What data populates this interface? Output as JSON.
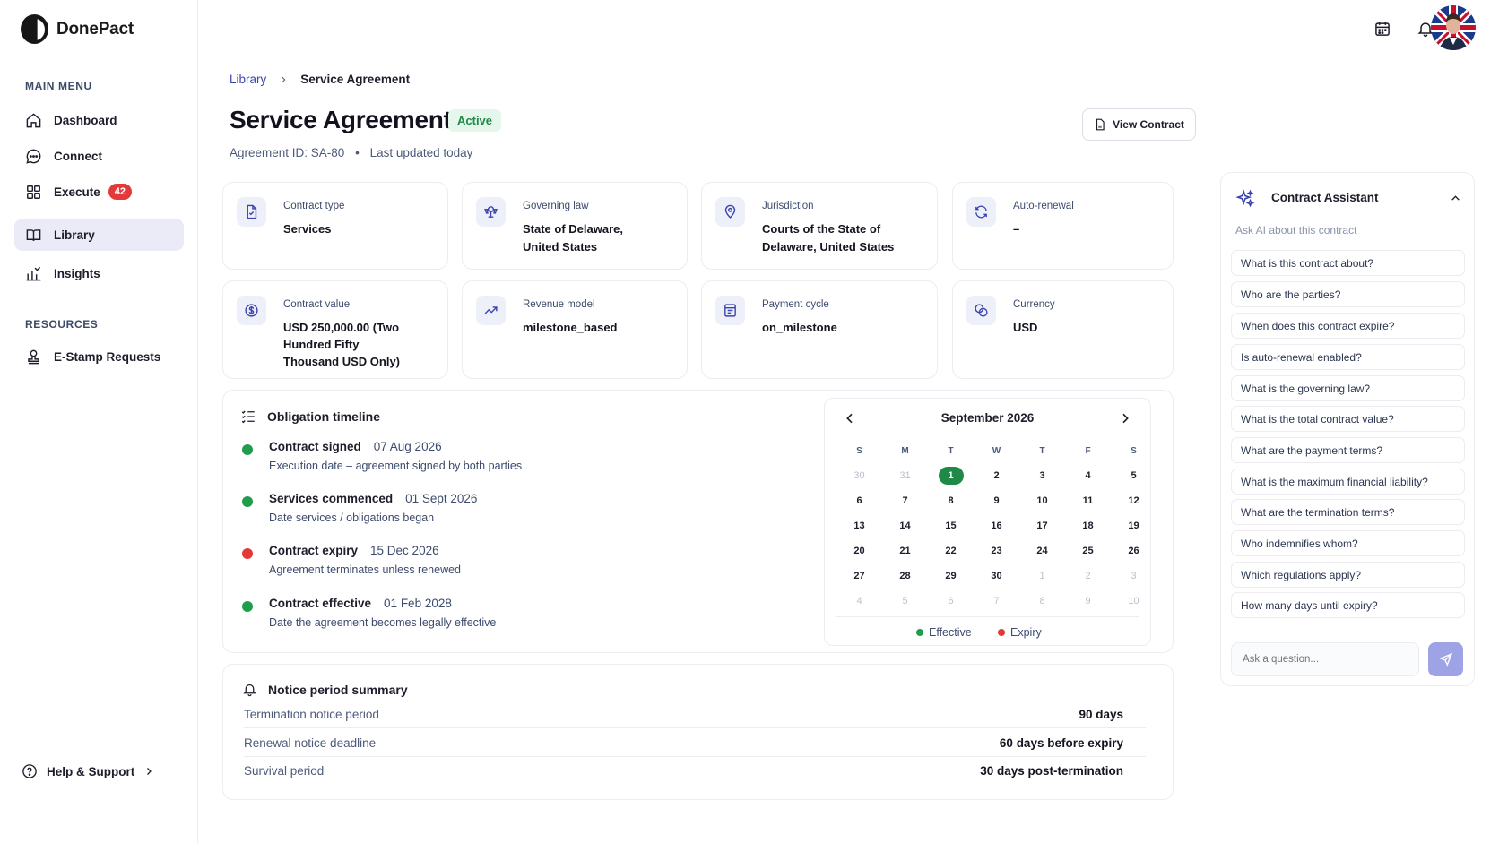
{
  "app": {
    "name": "DonePact"
  },
  "sidebar": {
    "main_heading": "MAIN MENU",
    "items": [
      {
        "label": "Dashboard",
        "icon": "home-icon"
      },
      {
        "label": "Connect",
        "icon": "chat-icon"
      },
      {
        "label": "Execute",
        "icon": "grid-icon",
        "badge": "42"
      },
      {
        "label": "Library",
        "icon": "book-icon",
        "active": true
      },
      {
        "label": "Insights",
        "icon": "chart-icon"
      }
    ],
    "resources_heading": "RESOURCES",
    "resources": [
      {
        "label": "E-Stamp Requests",
        "icon": "stamp-icon"
      }
    ],
    "help": "Help & Support"
  },
  "breadcrumb": {
    "parent": "Library",
    "current": "Service Agreement"
  },
  "page": {
    "title": "Service Agreement",
    "status": "Active",
    "agreement_id": "Agreement ID: SA-80",
    "updated": "Last updated today",
    "view_button": "View Contract"
  },
  "cards": [
    {
      "label": "Contract type",
      "value": "Services",
      "icon": "document-icon"
    },
    {
      "label": "Governing law",
      "value": "State of Delaware, United States",
      "icon": "law-icon"
    },
    {
      "label": "Jurisdiction",
      "value": "Courts of the State of Delaware, United States",
      "icon": "location-icon"
    },
    {
      "label": "Auto-renewal",
      "value": "–",
      "icon": "refresh-icon"
    },
    {
      "label": "Contract value",
      "value": "USD 250,000.00 (Two Hundred Fifty Thousand USD Only)",
      "icon": "dollar-icon"
    },
    {
      "label": "Revenue model",
      "value": "milestone_based",
      "icon": "trend-icon"
    },
    {
      "label": "Payment cycle",
      "value": "on_milestone",
      "icon": "receipt-icon"
    },
    {
      "label": "Currency",
      "value": "USD",
      "icon": "coins-icon"
    }
  ],
  "timeline": {
    "title": "Obligation timeline",
    "events": [
      {
        "name": "Contract signed",
        "date": "07 Aug 2026",
        "desc": "Execution date – agreement signed by both parties",
        "color": "#1f9d4c"
      },
      {
        "name": "Services commenced",
        "date": "01 Sept 2026",
        "desc": "Date services / obligations began",
        "color": "#1f9d4c"
      },
      {
        "name": "Contract expiry",
        "date": "15 Dec 2026",
        "desc": "Agreement terminates unless renewed",
        "color": "#e53935"
      },
      {
        "name": "Contract effective",
        "date": "01 Feb 2028",
        "desc": "Date the agreement becomes legally effective",
        "color": "#1f9d4c"
      }
    ]
  },
  "calendar": {
    "month": "September 2026",
    "weekdays": [
      "S",
      "M",
      "T",
      "W",
      "T",
      "F",
      "S"
    ],
    "weeks": [
      [
        "30",
        "31",
        "1",
        "2",
        "3",
        "4",
        "5"
      ],
      [
        "6",
        "7",
        "8",
        "9",
        "10",
        "11",
        "12"
      ],
      [
        "13",
        "14",
        "15",
        "16",
        "17",
        "18",
        "19"
      ],
      [
        "20",
        "21",
        "22",
        "23",
        "24",
        "25",
        "26"
      ],
      [
        "27",
        "28",
        "29",
        "30",
        "1",
        "2",
        "3"
      ],
      [
        "4",
        "5",
        "6",
        "7",
        "8",
        "9",
        "10"
      ]
    ],
    "selected": "1",
    "legend": [
      {
        "label": "Effective",
        "color": "#1f9d4c"
      },
      {
        "label": "Expiry",
        "color": "#e53935"
      }
    ]
  },
  "notice": {
    "title": "Notice period summary",
    "rows": [
      {
        "key": "Termination notice period",
        "value": "90 days"
      },
      {
        "key": "Renewal notice deadline",
        "value": "60 days before expiry"
      },
      {
        "key": "Survival period",
        "value": "30 days post-termination"
      }
    ]
  },
  "assistant": {
    "title": "Contract Assistant",
    "subtitle": "Ask AI about this contract",
    "questions": [
      "What is this contract about?",
      "Who are the parties?",
      "When does this contract expire?",
      "Is auto-renewal enabled?",
      "What is the governing law?",
      "What is the total contract value?",
      "What are the payment terms?",
      "What is the maximum financial liability?",
      "What are the termination terms?",
      "Who indemnifies whom?",
      "Which regulations apply?",
      "How many days until expiry?"
    ],
    "input_placeholder": "Ask a question...",
    "accent": "#9ea3e6"
  }
}
